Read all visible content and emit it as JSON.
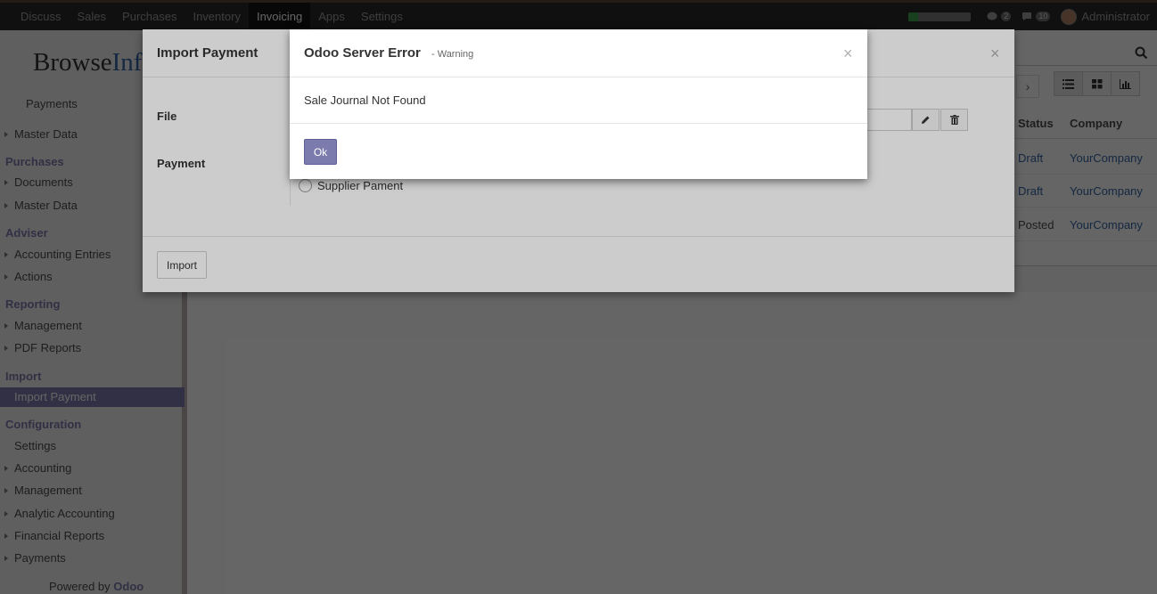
{
  "topbar": {
    "apps": [
      "Discuss",
      "Sales",
      "Purchases",
      "Inventory",
      "Invoicing",
      "Apps",
      "Settings"
    ],
    "active_app": "Invoicing",
    "progress_fraction": 0.15,
    "chat_count": "2",
    "message_count": "10",
    "user": "Administrator"
  },
  "sidebar": {
    "logo_part1": "Browse",
    "logo_part2": "Inf",
    "items": {
      "payments_top": "Payments",
      "master_data_1": "Master Data",
      "purchases_header": "Purchases",
      "documents": "Documents",
      "master_data_2": "Master Data",
      "adviser_header": "Adviser",
      "accounting_entries": "Accounting Entries",
      "actions": "Actions",
      "reporting_header": "Reporting",
      "management_1": "Management",
      "pdf_reports": "PDF Reports",
      "import_header": "Import",
      "import_payment": "Import Payment",
      "configuration_header": "Configuration",
      "settings": "Settings",
      "accounting": "Accounting",
      "management_2": "Management",
      "analytic_accounting": "Analytic Accounting",
      "financial_reports": "Financial Reports",
      "payments_bottom": "Payments"
    },
    "powered_prefix": "Powered by ",
    "powered_brand": "Odoo"
  },
  "list": {
    "columns": [
      "Status",
      "Company"
    ],
    "rows": [
      {
        "status": "Draft",
        "company": "YourCompany"
      },
      {
        "status": "Draft",
        "company": "YourCompany"
      },
      {
        "status": "Posted",
        "company": "YourCompany"
      }
    ]
  },
  "import_dialog": {
    "title": "Import Payment",
    "file_label": "File",
    "payment_label": "Payment",
    "radio_supplier": "Supplier Pament",
    "import_button": "Import",
    "close": "×"
  },
  "error_dialog": {
    "title": "Odoo Server Error",
    "subtitle": "- Warning",
    "message": "Sale Journal Not Found",
    "ok_button": "Ok",
    "close": "×"
  }
}
